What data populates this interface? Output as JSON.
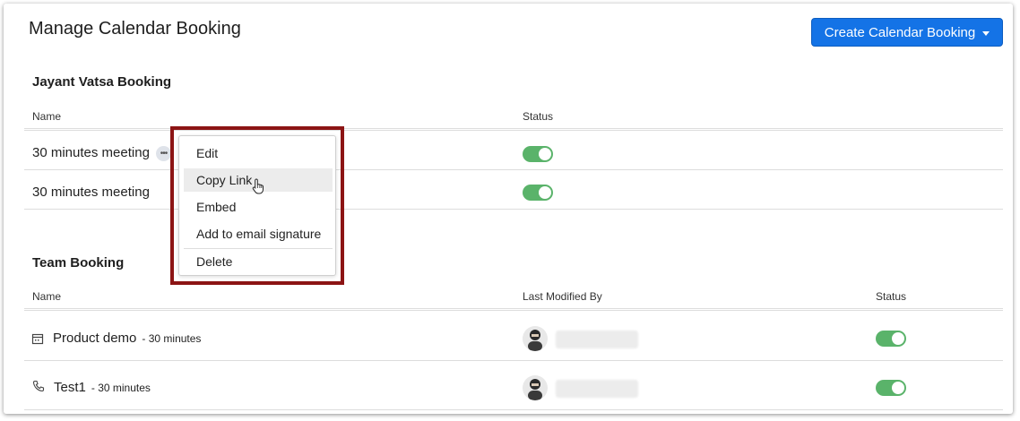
{
  "page": {
    "title": "Manage Calendar Booking"
  },
  "create_button": {
    "label": "Create Calendar Booking",
    "icon": "caret-down-icon"
  },
  "personal_section": {
    "title": "Jayant Vatsa Booking",
    "columns": {
      "name": "Name",
      "status": "Status"
    },
    "rows": [
      {
        "name": "30 minutes meeting",
        "status_on": true
      },
      {
        "name": "30 minutes meeting",
        "status_on": true
      }
    ]
  },
  "context_menu": {
    "items": [
      "Edit",
      "Copy Link",
      "Embed",
      "Add to email signature",
      "Delete"
    ],
    "active_item": "Copy Link"
  },
  "team_section": {
    "title": "Team Booking",
    "columns": {
      "name": "Name",
      "last_modified": "Last Modified By",
      "status": "Status"
    },
    "rows": [
      {
        "name": "Product demo",
        "duration": "- 30 minutes",
        "icon": "calendar-icon",
        "status_on": true
      },
      {
        "name": "Test1",
        "duration": "- 30 minutes",
        "icon": "phone-icon",
        "status_on": true
      }
    ]
  },
  "colors": {
    "primary": "#1473e6",
    "toggle_on": "#5ab36a",
    "highlight_border": "#8c1414"
  }
}
